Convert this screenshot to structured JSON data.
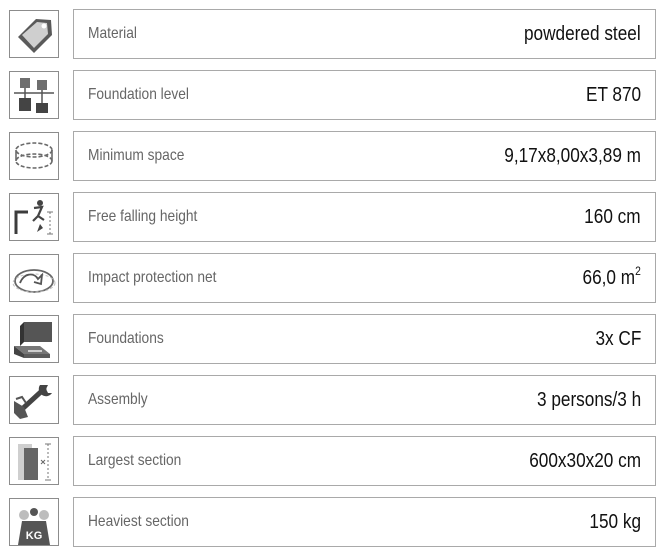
{
  "rows": [
    {
      "icon": "price-tag-icon",
      "label": "Material",
      "value": "powdered steel"
    },
    {
      "icon": "foundation-level-icon",
      "label": "Foundation level",
      "value": "ET 870"
    },
    {
      "icon": "minimum-space-icon",
      "label": "Minimum space",
      "value": "9,17x8,00x3,89 m"
    },
    {
      "icon": "falling-height-icon",
      "label": "Free falling height",
      "value": "160 cm"
    },
    {
      "icon": "protection-net-icon",
      "label": "Impact protection net",
      "value": "66,0 m",
      "value_sup": "2"
    },
    {
      "icon": "foundations-icon",
      "label": "Foundations",
      "value": "3x CF"
    },
    {
      "icon": "assembly-wrench-icon",
      "label": "Assembly",
      "value": "3 persons/3 h"
    },
    {
      "icon": "largest-section-icon",
      "label": "Largest section",
      "value": "600x30x20 cm"
    },
    {
      "icon": "weight-icon",
      "label": "Heaviest section",
      "value": "150 kg",
      "icon_text": "KG"
    }
  ]
}
